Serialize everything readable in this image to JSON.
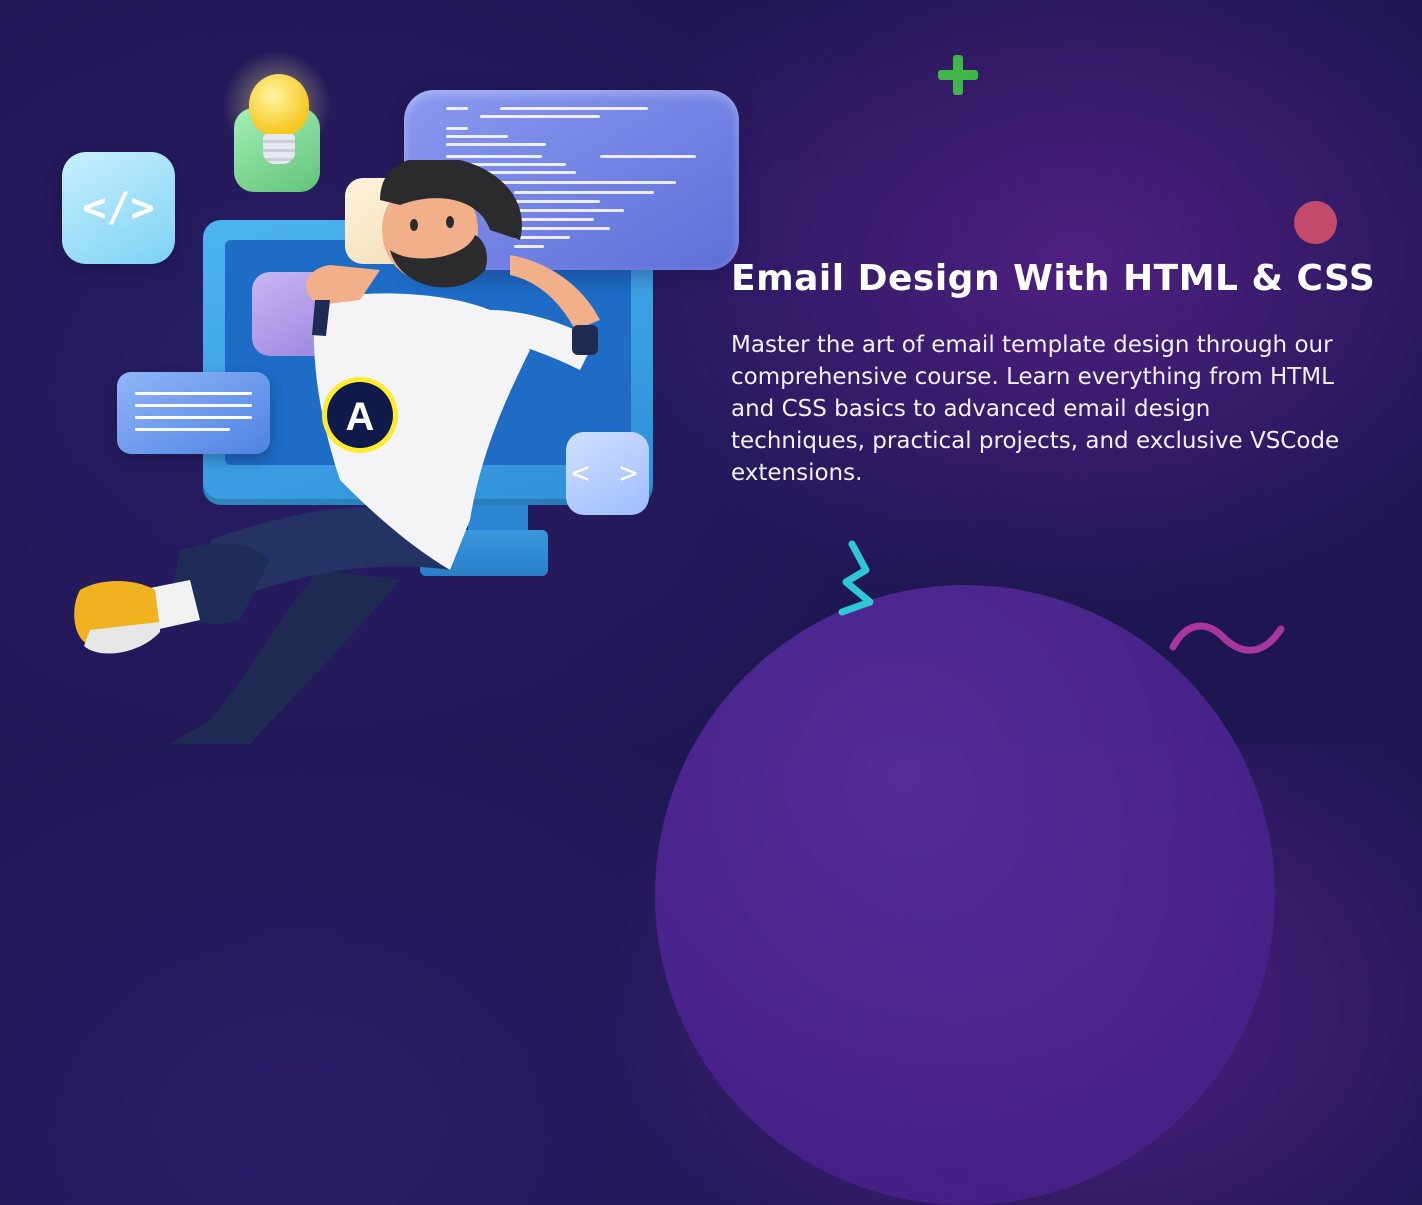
{
  "hero": {
    "title": "Email Design With HTML & CSS",
    "description": "Master the art of email template design through our comprehensive course. Learn everything from HTML and CSS basics to advanced email design techniques, practical projects, and exclusive VSCode extensions."
  },
  "illustration": {
    "code_tile_glyph": "</>",
    "angle_tile_glyph": "< >",
    "shirt_logo_letter": "A"
  },
  "colors": {
    "background": "#221a5c",
    "accent_purple": "#5a2ea0",
    "plus_green": "#3fb54a",
    "dot_red": "#c34a6a",
    "zigzag_teal": "#2fc7d6",
    "wave_magenta": "#a9359e"
  },
  "icons": [
    "plus-icon",
    "dot-decoration",
    "zigzag-icon",
    "wave-icon",
    "lightbulb-icon",
    "code-brackets-icon",
    "angle-brackets-icon"
  ]
}
